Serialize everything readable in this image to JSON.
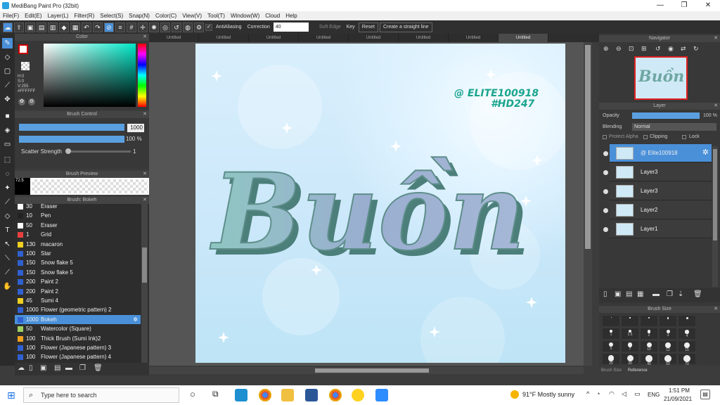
{
  "window": {
    "title": "MediBang Paint Pro (32bit)",
    "min": "—",
    "max": "❐",
    "close": "✕"
  },
  "menu": [
    "File(F)",
    "Edit(E)",
    "Layer(L)",
    "Filter(R)",
    "Select(S)",
    "Snap(N)",
    "Color(C)",
    "View(V)",
    "Tool(T)",
    "Window(W)",
    "Cloud",
    "Help"
  ],
  "toolbar": {
    "antialiasing": "AntiAliasing",
    "correction_label": "Correction",
    "correction_value": "40",
    "soft_edge": "Soft Edge",
    "key_label": "Key",
    "reset": "Reset",
    "straight_line": "Create a straight line"
  },
  "tabs": [
    "Untitled",
    "Untitled",
    "Untitled",
    "Untitled",
    "Untitled",
    "Untitled",
    "Untitled",
    "Untitled"
  ],
  "color_panel": {
    "title": "Color",
    "h": "H:0",
    "s": "S:0",
    "v": "V:255",
    "hex": "#FFFFFF"
  },
  "brush_control": {
    "title": "Brush Control",
    "size": "1000",
    "opacity": "100 %",
    "scatter_label": "Scatter Strength",
    "scatter_value": "1"
  },
  "brush_preview": {
    "title": "Brush Preview",
    "size_label": "72.5"
  },
  "brush_list": {
    "title": "Brush: Bokeh",
    "items": [
      {
        "size": "30",
        "name": "Eraser",
        "color": "#ffffff"
      },
      {
        "size": "10",
        "name": "Pen",
        "color": "#222222"
      },
      {
        "size": "50",
        "name": "Eraser",
        "color": "#ffffff"
      },
      {
        "size": "1",
        "name": "Grid",
        "color": "#e84040"
      },
      {
        "size": "130",
        "name": "macaron",
        "color": "#f0d020"
      },
      {
        "size": "100",
        "name": "Star",
        "color": "#3060d0"
      },
      {
        "size": "150",
        "name": "Snow flake 5",
        "color": "#3060d0"
      },
      {
        "size": "150",
        "name": "Snow flake 5",
        "color": "#3060d0"
      },
      {
        "size": "200",
        "name": "Paint 2",
        "color": "#3060d0"
      },
      {
        "size": "200",
        "name": "Paint 2",
        "color": "#3060d0"
      },
      {
        "size": "45",
        "name": "Sumi 4",
        "color": "#f0d020"
      },
      {
        "size": "1000",
        "name": "Flower (geometric pattern) 2",
        "color": "#3060d0"
      },
      {
        "size": "1000",
        "name": "Bokeh",
        "color": "#3060d0"
      },
      {
        "size": "50",
        "name": "Watercolor (Square)",
        "color": "#a0d060"
      },
      {
        "size": "100",
        "name": "Thick Brush (Sumi Ink)2",
        "color": "#f0a020"
      },
      {
        "size": "100",
        "name": "Flower (Japanese pattern) 3",
        "color": "#3060d0"
      },
      {
        "size": "100",
        "name": "Flower (Japanese pattern) 4",
        "color": "#3060d0"
      }
    ],
    "selected_index": 12
  },
  "artwork": {
    "text": "Buồn",
    "credit1": "@ ELITE100918",
    "credit2": "#HD247"
  },
  "navigator": {
    "title": "Navigator"
  },
  "layer_panel": {
    "title": "Layer",
    "opacity_label": "Opacity",
    "opacity_value": "100 %",
    "blending_label": "Blending",
    "blending_value": "Normal",
    "protect_alpha": "Protect Alpha",
    "clipping": "Clipping",
    "lock": "Lock",
    "layers": [
      {
        "name": "@ Elite100918",
        "selected": true
      },
      {
        "name": "Layer3",
        "selected": false
      },
      {
        "name": "Layer3",
        "selected": false
      },
      {
        "name": "Layer2",
        "selected": false
      },
      {
        "name": "Layer1",
        "selected": false
      }
    ]
  },
  "brush_size_panel": {
    "title": "Brush Size",
    "tab1": "Brush Size",
    "tab2": "Reference",
    "values": [
      "",
      "",
      "",
      "",
      "",
      "1",
      "1.5",
      "2",
      "3",
      "4",
      "5",
      "7",
      "10",
      "12",
      "15",
      "20",
      "30",
      "40",
      "50",
      "70"
    ]
  },
  "taskbar": {
    "search_placeholder": "Type here to search",
    "weather": "91°F  Mostly sunny",
    "lang": "ENG",
    "time": "1:51 PM",
    "date": "21/09/2021"
  }
}
